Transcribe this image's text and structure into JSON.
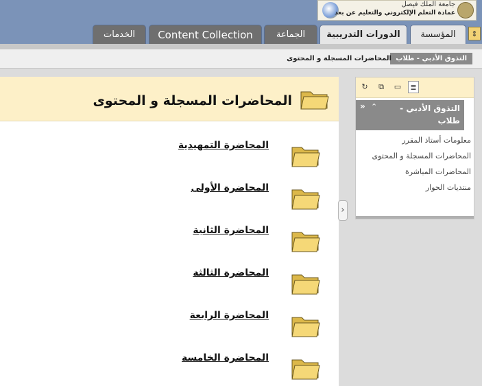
{
  "header": {
    "logo_line1": "جامعة الملك فيصل",
    "logo_line2": "عمادة التعلم الإلكتروني والتعليم عن بعد"
  },
  "tabs": [
    {
      "label": "الخدمات",
      "active": false
    },
    {
      "label": "Content Collection",
      "active": false
    },
    {
      "label": "الجماعة",
      "active": false
    },
    {
      "label": "الدورات التدريبية",
      "active": true
    },
    {
      "label": "المؤسسة",
      "active": false
    }
  ],
  "breadcrumb": {
    "course": "التذوق الأدبي - طلاب",
    "current": "المحاضرات المسجلة و المحتوى"
  },
  "sidebar": {
    "course_title": "التذوق الأدبي - طلاب",
    "links": [
      "معلومات أستاذ المقرر",
      "المحاضرات المسجلة و المحتوى",
      "المحاضرات المباشرة",
      "منتديات الحوار"
    ]
  },
  "main": {
    "title": "المحاضرات المسجلة و المحتوى",
    "items": [
      "المحاضرة التمهيدية",
      "المحاضرة الأولى",
      "المحاضرة الثانية",
      "المحاضرة الثالثة",
      "المحاضرة الرابعة",
      "المحاضرة الخامسة"
    ]
  },
  "colors": {
    "top_bar": "#7b93b8",
    "header_band": "#fdf0c8",
    "folder": "#f2d275"
  }
}
